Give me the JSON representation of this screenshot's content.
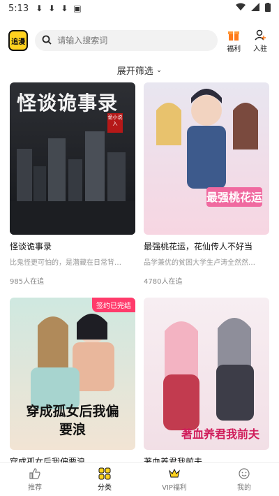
{
  "status": {
    "time": "5:13"
  },
  "header": {
    "logo_text": "追漫",
    "search_placeholder": "请输入搜索词",
    "welfare_label": "福利",
    "join_label": "入驻"
  },
  "filter": {
    "label": "展开筛选"
  },
  "cards": [
    {
      "title": "怪谈诡事录",
      "desc": "比鬼怪更可怕的，是潜藏在日常背…",
      "followers": "985人在追",
      "cover_title": "怪谈诡事录",
      "cover_seal": "诡小说入"
    },
    {
      "title": "最强桃花运，花仙传人不好当",
      "desc": "品学兼优的贫困大学生卢涛全然然…",
      "followers": "4780人在追",
      "cover_title": "最强桃花运"
    },
    {
      "title": "穿成孤女后我偏要浪",
      "desc": "",
      "followers": "",
      "cover_tag": "签约已完结",
      "cover_title": "穿成孤女后我偏要浪"
    },
    {
      "title": "著血养君我前夫",
      "desc": "",
      "followers": "",
      "cover_title": "著血养君我前夫"
    }
  ],
  "tabbar": {
    "items": [
      {
        "label": "推荐"
      },
      {
        "label": "分类"
      },
      {
        "label": "VIP福利"
      },
      {
        "label": "我的"
      }
    ]
  },
  "colors": {
    "accent": "#ffd21f",
    "tag": "#ff3b6b"
  }
}
